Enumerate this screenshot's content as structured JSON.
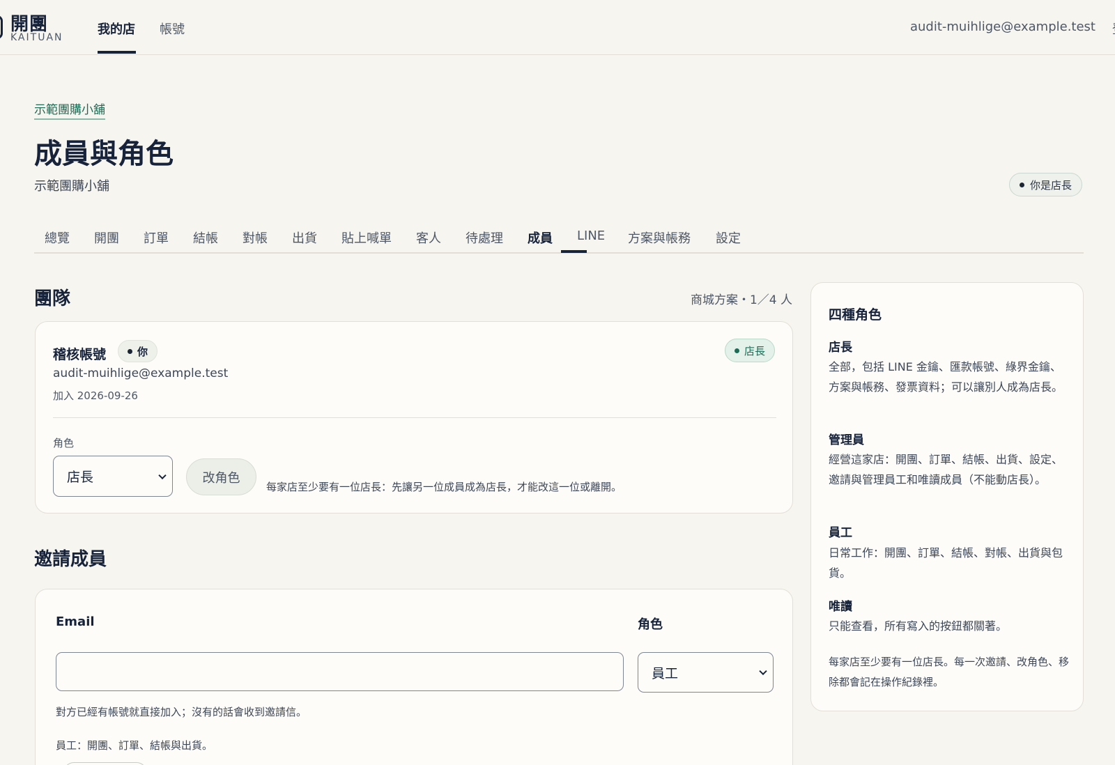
{
  "header": {
    "logo_zh": "開團",
    "logo_en": "KAITUAN",
    "nav": [
      "我的店",
      "帳號"
    ],
    "user_email": "audit-muihlige@example.test",
    "edge_text": "登"
  },
  "breadcrumb": "示範團購小舖",
  "page": {
    "title": "成員與角色",
    "subtitle": "示範團購小舖",
    "owner_chip": "你是店長"
  },
  "tabs": [
    "總覽",
    "開團",
    "訂單",
    "結帳",
    "對帳",
    "出貨",
    "貼上喊單",
    "客人",
    "待處理",
    "成員",
    "LINE",
    "方案與帳務",
    "設定"
  ],
  "active_tab": "成員",
  "team": {
    "title": "團隊",
    "plan_count": "商城方案・1／4 人",
    "member": {
      "name": "稽核帳號",
      "you_label": "你",
      "role_badge": "店長",
      "email": "audit-muihlige@example.test",
      "joined": "加入 2026-09-26",
      "role_label": "角色",
      "role_value": "店長",
      "change_role_button": "改角色",
      "note": "每家店至少要有一位店長：先讓另一位成員成為店長，才能改這一位或離開。"
    }
  },
  "invite": {
    "title": "邀請成員",
    "email_label": "Email",
    "email_value": "",
    "role_label": "角色",
    "role_value": "員工",
    "hint": "對方已經有帳號就直接加入；沒有的話會收到邀請信。",
    "role_desc": "員工：開團、訂單、結帳與出貨。"
  },
  "roles": {
    "title": "四種角色",
    "items": [
      {
        "name": "店長",
        "desc": "全部，包括 LINE 金鑰、匯款帳號、綠界金鑰、方案與帳務、發票資料；可以讓別人成為店長。"
      },
      {
        "name": "管理員",
        "desc": "經營這家店：開團、訂單、結帳、出貨、設定、邀請與管理員工和唯讀成員（不能動店長）。"
      },
      {
        "name": "員工",
        "desc": "日常工作：開團、訂單、結帳、對帳、出貨與包貨。"
      },
      {
        "name": "唯讀",
        "desc": "只能查看，所有寫入的按鈕都關著。"
      }
    ],
    "footer": "每家店至少要有一位店長。每一次邀請、改角色、移除都會記在操作紀錄裡。"
  },
  "colors": {
    "background": "#f7f5f0",
    "ink": "#17233a",
    "accent_green": "#1e6b55"
  }
}
